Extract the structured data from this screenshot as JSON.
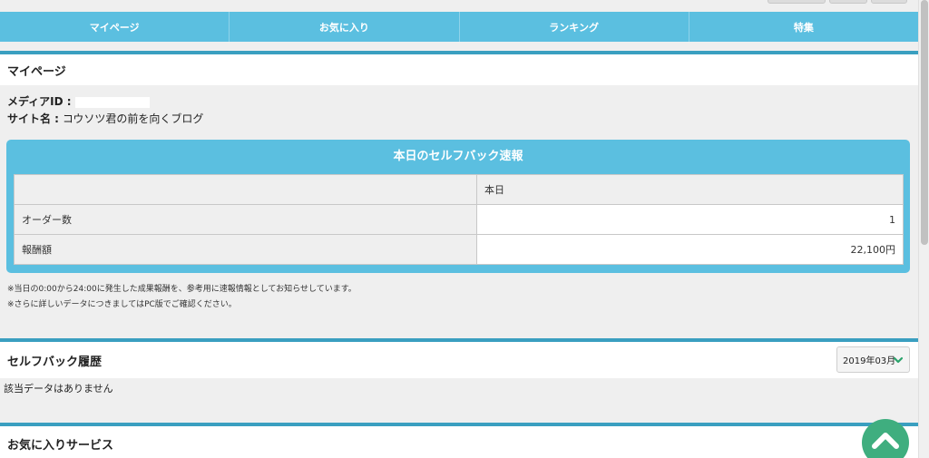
{
  "nav": {
    "items": [
      "マイページ",
      "お気に入り",
      "ランキング",
      "特集"
    ]
  },
  "mypage": {
    "title": "マイページ",
    "media_id_label": "メディアID :",
    "site_name_label": "サイト名 :",
    "site_name_value": "コウソツ君の前を向くブログ"
  },
  "selfback": {
    "panel_title": "本日のセルフバック速報",
    "col_header": "本日",
    "rows": [
      {
        "label": "オーダー数",
        "value": "1"
      },
      {
        "label": "報酬額",
        "value": "22,100円"
      }
    ],
    "notes": [
      "※当日の0:00から24:00に発生した成果報酬を、参考用に速報情報としてお知らせしています。",
      "※さらに詳しいデータにつきましてはPC版でご確認ください。"
    ]
  },
  "history": {
    "title": "セルフバック履歴",
    "selected_month": "2019年03月",
    "empty_text": "該当データはありません"
  },
  "favorites": {
    "title": "お気に入りサービス"
  },
  "colors": {
    "accent": "#5bbfe0",
    "border": "#3a9fc0",
    "page_top": "#3fae7f"
  }
}
